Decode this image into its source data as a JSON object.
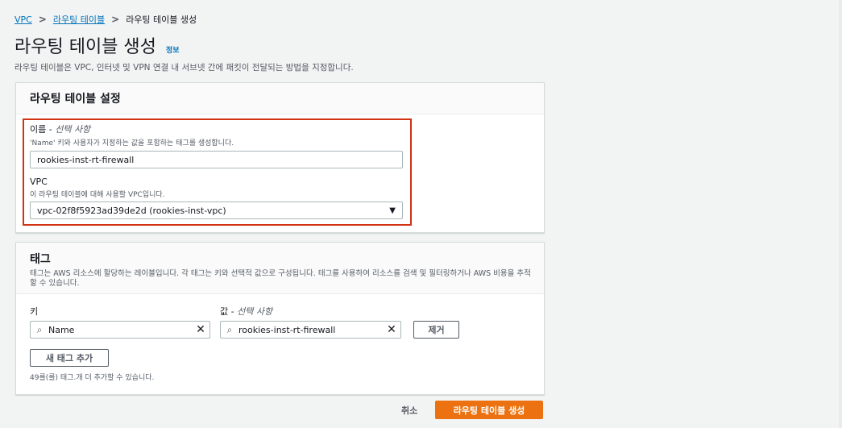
{
  "breadcrumb": {
    "root": "VPC",
    "parent": "라우팅 테이블",
    "current": "라우팅 테이블 생성"
  },
  "page": {
    "title": "라우팅 테이블 생성",
    "info": "정보",
    "description": "라우팅 테이블은 VPC, 인터넷 및 VPN 연결 내 서브넷 간에 패킷이 전달되는 방법을 지정합니다."
  },
  "settings": {
    "title": "라우팅 테이블 설정",
    "name_label": "이름 - ",
    "name_optional": "선택 사항",
    "name_desc": "'Name' 키와 사용자가 지정하는 값을 포함하는 태그를 생성합니다.",
    "name_value": "rookies-inst-rt-firewall",
    "vpc_label": "VPC",
    "vpc_desc": "이 라우팅 테이블에 대해 사용할 VPC입니다.",
    "vpc_value": "vpc-02f8f5923ad39de2d (rookies-inst-vpc)"
  },
  "tags": {
    "title": "태그",
    "description": "태그는 AWS 리소스에 할당하는 레이블입니다. 각 태그는 키와 선택적 값으로 구성됩니다. 태그를 사용하여 리소스를 검색 및 필터링하거나 AWS 비용을 추적할 수 있습니다.",
    "key_label": "키",
    "value_label": "값 - ",
    "value_optional": "선택 사항",
    "rows": [
      {
        "key": "Name",
        "value": "rookies-inst-rt-firewall",
        "remove": "제거"
      }
    ],
    "add_button": "새 태그 추가",
    "limit_note": "49를(를) 태그.개 더 추가할 수 있습니다."
  },
  "footer": {
    "cancel": "취소",
    "submit": "라우팅 테이블 생성"
  },
  "colors": {
    "accent": "#ec7211",
    "link": "#0073bb",
    "highlight": "#d13212"
  },
  "icons": {
    "search": "search-icon",
    "clear": "close-icon",
    "dropdown": "caret-down-icon"
  }
}
